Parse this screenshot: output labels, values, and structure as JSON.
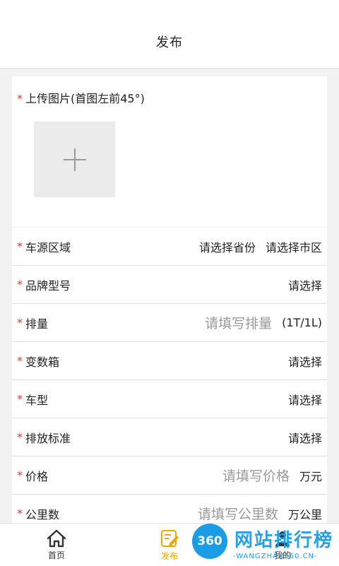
{
  "header": {
    "title": "发布"
  },
  "upload": {
    "required_mark": "*",
    "label": "上传图片(首图左前45°)"
  },
  "form": {
    "rows": [
      {
        "label": "车源区域",
        "select1": "请选择省份",
        "select2": "请选择市区"
      },
      {
        "label": "品牌型号",
        "select": "请选择"
      },
      {
        "label": "排量",
        "placeholder": "请填写排量",
        "unit": "(1T/1L)"
      },
      {
        "label": "变数箱",
        "select": "请选择"
      },
      {
        "label": "车型",
        "select": "请选择"
      },
      {
        "label": "排放标准",
        "select": "请选择"
      },
      {
        "label": "价格",
        "placeholder": "请填写价格",
        "unit": "万元"
      },
      {
        "label": "公里数",
        "placeholder": "请填写公里数",
        "unit": "万公里"
      }
    ]
  },
  "tabbar": {
    "items": [
      {
        "label": "首页",
        "icon": "home-icon"
      },
      {
        "label": "发布",
        "icon": "edit-icon"
      },
      {
        "label": "我的",
        "icon": "user-icon"
      }
    ],
    "active": "发布",
    "active_color": "#f0a500"
  },
  "watermark": {
    "badge": "360",
    "text": "网站排行榜",
    "sub": "-WANGZHAN360.CN-"
  },
  "colors": {
    "required": "#e23a2e",
    "accent": "#f0a500",
    "watermark": "#1a9ce6"
  }
}
